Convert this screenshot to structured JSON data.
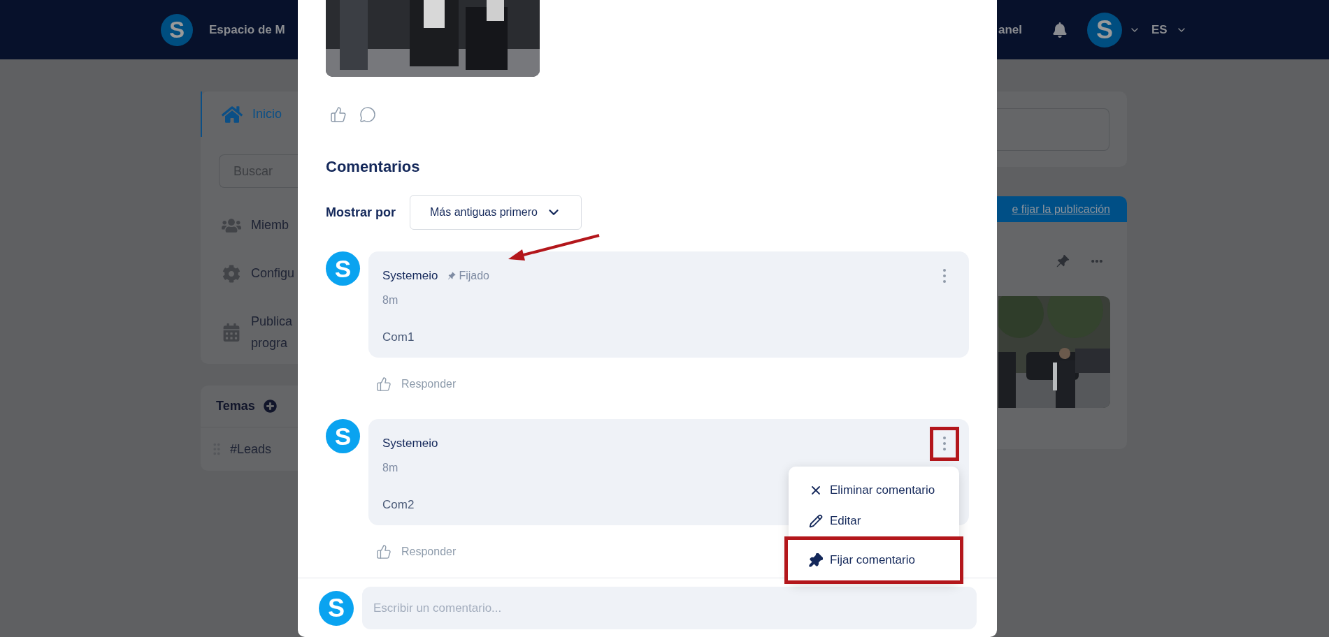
{
  "header": {
    "logo_letter": "S",
    "brand": "Espacio de M",
    "nav_link": "anel",
    "avatar_letter": "S",
    "language": "ES"
  },
  "sidebar": {
    "items": [
      {
        "kind": "home",
        "label": "Inicio",
        "selected": true
      },
      {
        "kind": "members",
        "label": "Miemb",
        "selected": false
      },
      {
        "kind": "settings",
        "label": "Configu",
        "selected": false
      },
      {
        "kind": "scheduled",
        "label": "Publica",
        "label_line_2": "progra",
        "selected": false
      }
    ],
    "search": {
      "placeholder": "Buscar"
    },
    "topics": {
      "title": "Temas",
      "items": [
        {
          "label": "#Leads"
        }
      ]
    }
  },
  "right_panel": {
    "pinned_banner": {
      "link": "e fijar la publicación"
    }
  },
  "modal": {
    "comments_title": "Comentarios",
    "sort": {
      "label": "Mostrar por",
      "value": "Más antiguas primero"
    },
    "comments": [
      {
        "avatar_letter": "S",
        "author": "Systemeio",
        "pinned": true,
        "pinned_label": "Fijado",
        "time": "8m",
        "text": "Com1",
        "reply": "Responder",
        "menu_open": false,
        "menu_annotated": false
      },
      {
        "avatar_letter": "S",
        "author": "Systemeio",
        "pinned": false,
        "time": "8m",
        "text": "Com2",
        "reply": "Responder",
        "menu_open": true,
        "menu_annotated": true
      }
    ],
    "menu": {
      "items": [
        {
          "kind": "delete",
          "label": "Eliminar comentario",
          "annotated": false
        },
        {
          "kind": "edit",
          "label": "Editar",
          "annotated": false
        },
        {
          "kind": "pin",
          "label": "Fijar comentario",
          "annotated": true
        }
      ]
    },
    "composer": {
      "avatar_letter": "S",
      "placeholder": "Escribir un comentario..."
    }
  }
}
